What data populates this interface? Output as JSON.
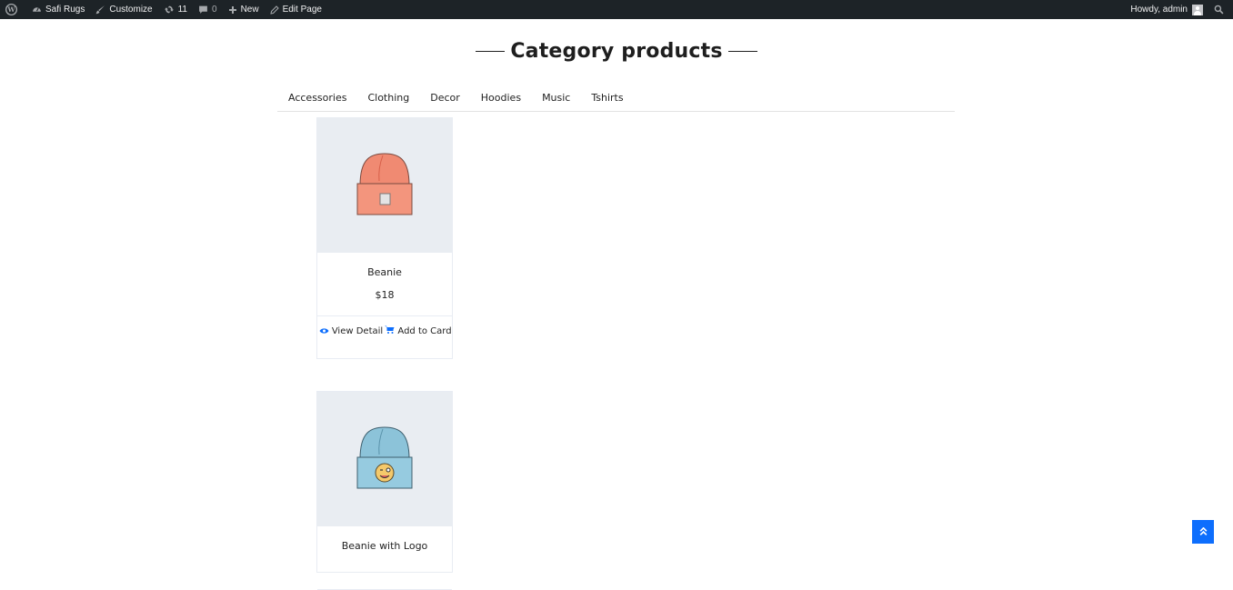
{
  "adminbar": {
    "site_name": "Safi Rugs",
    "customize": "Customize",
    "updates_count": "11",
    "comments_count": "0",
    "new": "New",
    "edit_page": "Edit Page",
    "greeting": "Howdy, admin"
  },
  "header": {
    "title": "Category products"
  },
  "tabs": [
    {
      "label": "Accessories"
    },
    {
      "label": "Clothing"
    },
    {
      "label": "Decor"
    },
    {
      "label": "Hoodies"
    },
    {
      "label": "Music"
    },
    {
      "label": "Tshirts"
    }
  ],
  "products": [
    {
      "name": "Beanie",
      "price": "$18",
      "view_label": "View Detail",
      "cart_label": "Add to Card",
      "color": "#f08a72"
    },
    {
      "name": "Beanie with Logo",
      "color": "#8cc3d9"
    }
  ],
  "colors": {
    "accent": "#0d6efd",
    "adminbar": "#1d2327"
  }
}
